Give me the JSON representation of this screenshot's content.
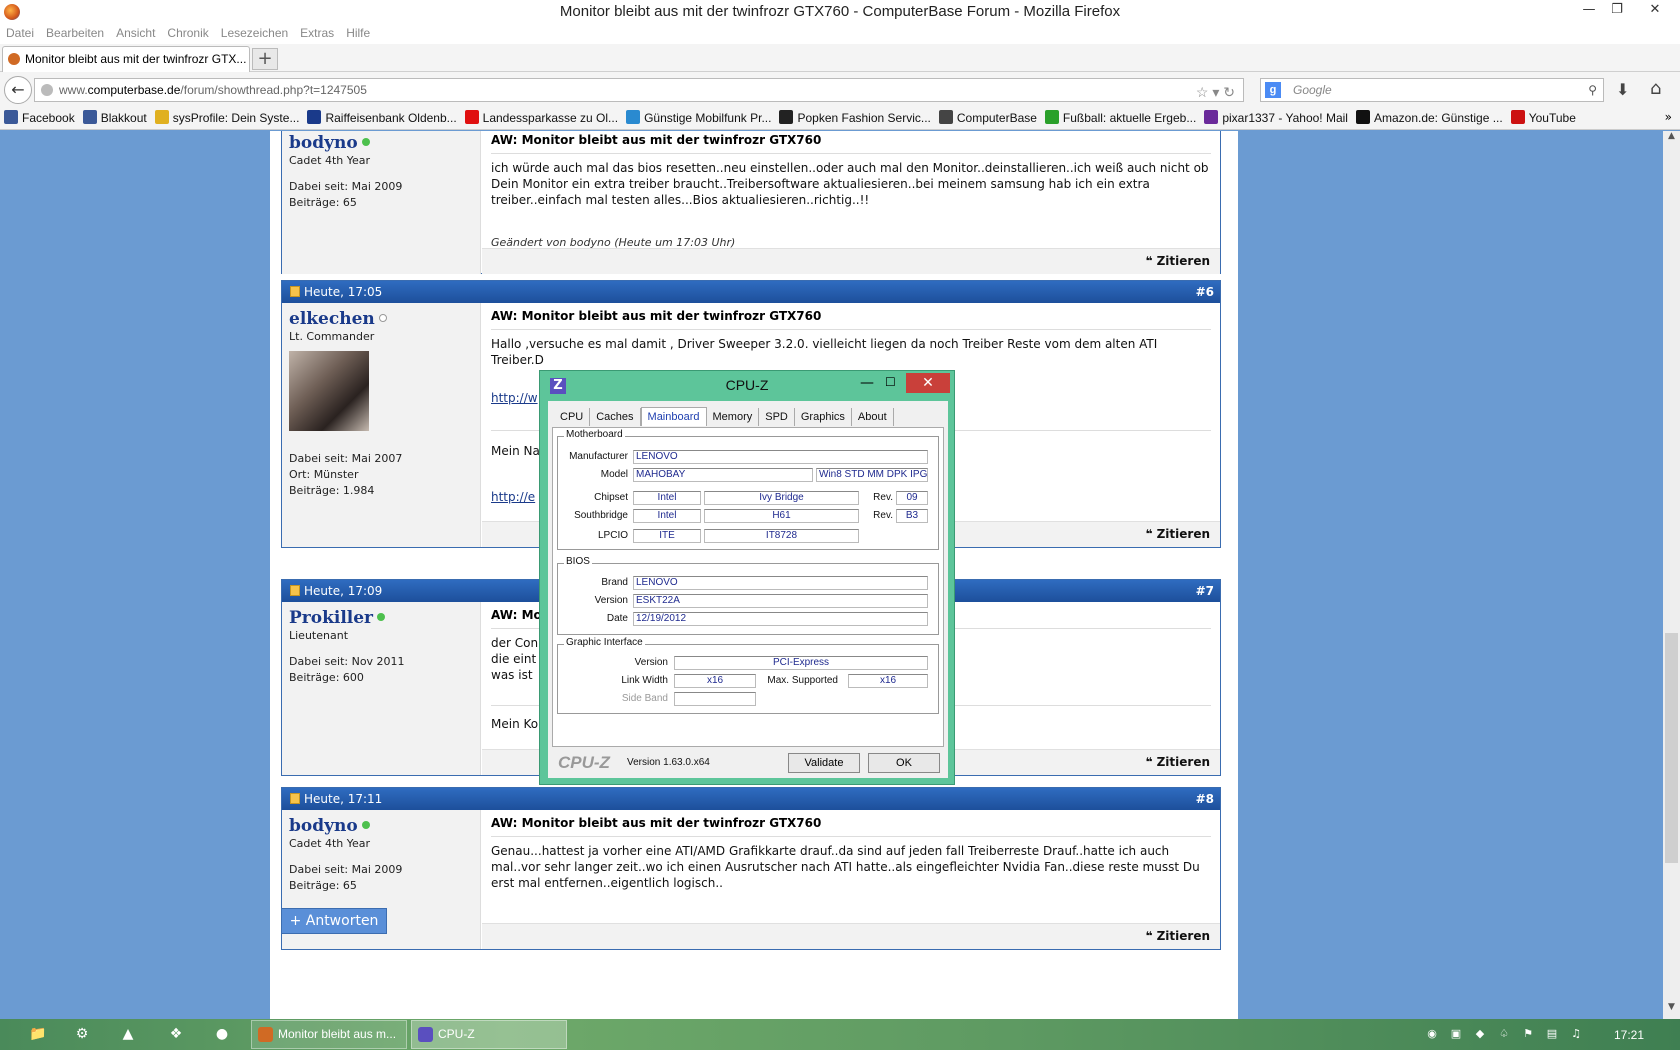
{
  "window": {
    "title": "Monitor bleibt aus mit der twinfrozr GTX760 - ComputerBase Forum - Mozilla Firefox"
  },
  "menu": [
    "Datei",
    "Bearbeiten",
    "Ansicht",
    "Chronik",
    "Lesezeichen",
    "Extras",
    "Hilfe"
  ],
  "tab": {
    "label": "Monitor bleibt aus mit der twinfrozr GTX...",
    "new_tab": "+"
  },
  "nav": {
    "url_prefix": "www.",
    "url_domain": "computerbase.de",
    "url_path": "/forum/showthread.php?t=1247505",
    "search_placeholder": "Google"
  },
  "bookmarks": [
    {
      "label": "Facebook",
      "color": "#3b5998"
    },
    {
      "label": "Blakkout",
      "color": "#3b5998"
    },
    {
      "label": "sysProfile: Dein Syste...",
      "color": "#e0b020"
    },
    {
      "label": "Raiffeisenbank Oldenb...",
      "color": "#1a3a8a"
    },
    {
      "label": "Landessparkasse zu Ol...",
      "color": "#e01010"
    },
    {
      "label": "Günstige Mobilfunk Pr...",
      "color": "#2a8ad0"
    },
    {
      "label": "Popken Fashion Servic...",
      "color": "#222222"
    },
    {
      "label": "ComputerBase",
      "color": "#444444"
    },
    {
      "label": "Fußball: aktuelle Ergeb...",
      "color": "#2aa02a"
    },
    {
      "label": "pixar1337 - Yahoo! Mail",
      "color": "#6a2a9a"
    },
    {
      "label": "Amazon.de: Günstige ...",
      "color": "#111111"
    },
    {
      "label": "YouTube",
      "color": "#cc1111"
    }
  ],
  "posts": [
    {
      "user": "bodyno",
      "online": true,
      "rank": "Cadet 4th Year",
      "meta": [
        "Dabei seit: Mai 2009",
        "Beiträge: 65"
      ],
      "title": "AW: Monitor bleibt aus mit der twinfrozr GTX760",
      "text": "ich würde auch mal das bios resetten..neu einstellen..oder auch mal den Monitor..deinstallieren..ich weiß auch nicht ob Dein Monitor ein extra treiber braucht..Treibersoftware aktualiesieren..bei meinem samsung hab ich ein extra treiber..einfach mal testen alles...Bios aktualiesieren..richtig..!!",
      "edited_prefix": "Geändert von bodyno (Heute um ",
      "edited_time": "17:03",
      "edited_suffix": " Uhr)",
      "quote": "Zitieren"
    },
    {
      "date": "Heute, 17:05",
      "num": "#6",
      "user": "elkechen",
      "online": false,
      "rank": "Lt. Commander",
      "meta": [
        "Dabei seit: Mai 2007",
        "Ort: Münster",
        "Beiträge: 1.984"
      ],
      "title": "AW: Monitor bleibt aus mit der twinfrozr GTX760",
      "text": "Hallo ,versuche es mal damit , Driver Sweeper 3.2.0. vielleicht liegen da noch Treiber Reste vom dem alten ATI Treiber.D",
      "link1": "http://w",
      "sig": "Mein Na",
      "link2": "http://e",
      "quote": "Zitieren"
    },
    {
      "date": "Heute, 17:09",
      "num": "#7",
      "user": "Prokiller",
      "online": true,
      "rank": "Lieutenant",
      "meta": [
        "Dabei seit: Nov 2011",
        "Beiträge: 600"
      ],
      "title": "AW: Mo",
      "lines": [
        "der Con",
        "die eint",
        "was ist"
      ],
      "sig": "Mein Ko",
      "quote": "Zitieren"
    },
    {
      "date": "Heute, 17:11",
      "num": "#8",
      "user": "bodyno",
      "online": true,
      "rank": "Cadet 4th Year",
      "meta": [
        "Dabei seit: Mai 2009",
        "Beiträge: 65"
      ],
      "title": "AW: Monitor bleibt aus mit der twinfrozr GTX760",
      "text": "Genau...hattest ja vorher eine ATI/AMD Grafikkarte drauf..da sind auf jeden fall Treiberreste Drauf..hatte ich auch mal..vor sehr langer zeit..wo ich einen Ausrutscher nach ATI hatte..als eingefleichter Nvidia Fan..diese reste musst Du erst mal entfernen..eigentlich logisch..",
      "quote": "Zitieren"
    }
  ],
  "reply_button": "+ Antworten",
  "cpuz": {
    "title": "CPU-Z",
    "tabs": [
      "CPU",
      "Caches",
      "Mainboard",
      "Memory",
      "SPD",
      "Graphics",
      "About"
    ],
    "active_tab": "Mainboard",
    "motherboard": {
      "legend": "Motherboard",
      "manufacturer_label": "Manufacturer",
      "manufacturer": "LENOVO",
      "model_label": "Model",
      "model": "MAHOBAY",
      "model_extra": "Win8 STD MM DPK IPG",
      "chipset_label": "Chipset",
      "chipset_vendor": "Intel",
      "chipset": "Ivy Bridge",
      "chipset_rev_label": "Rev.",
      "chipset_rev": "09",
      "southbridge_label": "Southbridge",
      "southbridge_vendor": "Intel",
      "southbridge": "H61",
      "southbridge_rev_label": "Rev.",
      "southbridge_rev": "B3",
      "lpcio_label": "LPCIO",
      "lpcio_vendor": "ITE",
      "lpcio": "IT8728"
    },
    "bios": {
      "legend": "BIOS",
      "brand_label": "Brand",
      "brand": "LENOVO",
      "version_label": "Version",
      "version": "ESKT22A",
      "date_label": "Date",
      "date": "12/19/2012"
    },
    "graphic": {
      "legend": "Graphic Interface",
      "version_label": "Version",
      "version": "PCI-Express",
      "link_width_label": "Link Width",
      "link_width": "x16",
      "max_supported_label": "Max. Supported",
      "max_supported": "x16",
      "side_band_label": "Side Band",
      "side_band": ""
    },
    "logo": "CPU-Z",
    "version": "Version 1.63.0.x64",
    "validate": "Validate",
    "ok": "OK"
  },
  "taskbar": {
    "tasks": [
      {
        "label": "Monitor bleibt aus m...",
        "color": "#d06a24"
      },
      {
        "label": "CPU-Z",
        "color": "#5a4fbf"
      }
    ],
    "clock": "17:21"
  }
}
